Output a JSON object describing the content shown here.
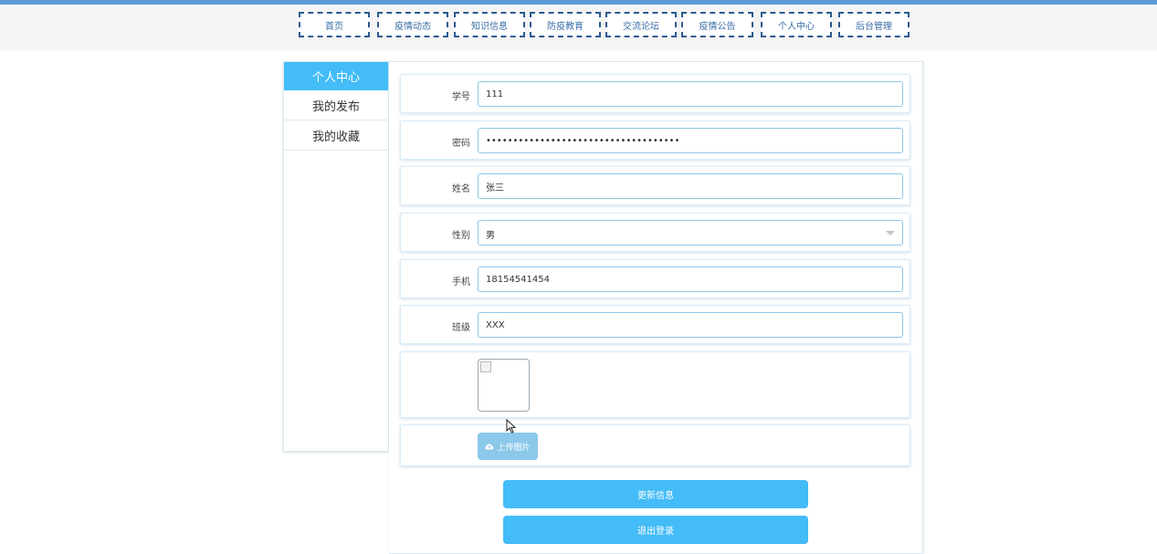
{
  "nav": {
    "items": [
      "首页",
      "疫情动态",
      "知识信息",
      "防疫教育",
      "交流论坛",
      "疫情公告",
      "个人中心",
      "后台管理"
    ]
  },
  "sidebar": {
    "title": "个人中心",
    "items": [
      "我的发布",
      "我的收藏"
    ]
  },
  "form": {
    "student_id": {
      "label": "学号",
      "value": "111"
    },
    "password": {
      "label": "密码",
      "value": "••••••••••••••••••••••••••••••••••••"
    },
    "name": {
      "label": "姓名",
      "value": "张三"
    },
    "gender": {
      "label": "性别",
      "value": "男"
    },
    "phone": {
      "label": "手机",
      "value": "18154541454"
    },
    "class": {
      "label": "班级",
      "value": "XXX"
    },
    "upload_label": "上传图片"
  },
  "actions": {
    "update": "更新信息",
    "logout": "退出登录"
  },
  "colors": {
    "accent": "#43bcf7",
    "nav_border": "#2b5a91",
    "top_bar": "#5b9bd5"
  },
  "icons": {
    "upload": "cloud-upload-icon",
    "select": "chevron-down-icon",
    "image": "broken-image-icon",
    "cursor": "mouse-cursor-icon"
  }
}
